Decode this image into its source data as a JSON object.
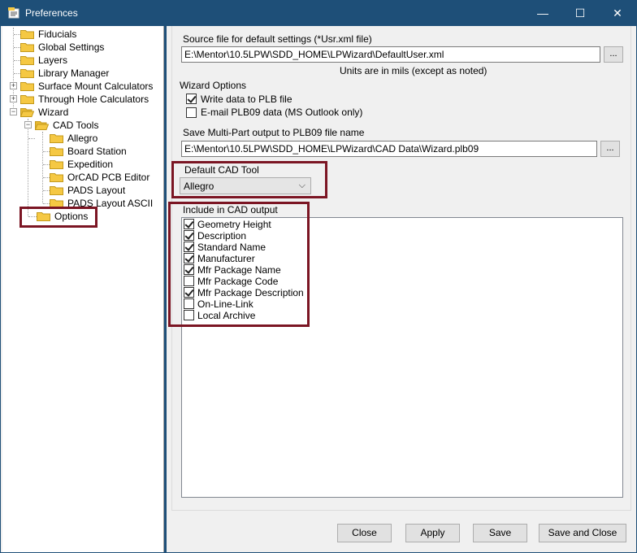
{
  "window": {
    "title": "Preferences"
  },
  "tree": {
    "items": [
      {
        "label": "Fiducials"
      },
      {
        "label": "Global Settings"
      },
      {
        "label": "Layers"
      },
      {
        "label": "Library Manager"
      },
      {
        "label": "Surface Mount Calculators"
      },
      {
        "label": "Through Hole Calculators"
      },
      {
        "label": "Wizard"
      },
      {
        "label": "CAD Tools"
      },
      {
        "label": "Allegro"
      },
      {
        "label": "Board Station"
      },
      {
        "label": "Expedition"
      },
      {
        "label": "OrCAD PCB Editor"
      },
      {
        "label": "PADS Layout"
      },
      {
        "label": "PADS Layout ASCII"
      },
      {
        "label": "Options"
      }
    ],
    "expand_plus": "+",
    "expand_minus": "−"
  },
  "source": {
    "label": "Source file for default settings (*Usr.xml file)",
    "value": "E:\\Mentor\\10.5LPW\\SDD_HOME\\LPWizard\\DefaultUser.xml",
    "browse": "...",
    "units_note": "Units are in mils (except as noted)"
  },
  "wizard_options": {
    "label": "Wizard Options",
    "write_plb": {
      "label": "Write data to PLB file",
      "checked": true
    },
    "email_plb": {
      "label": "E-mail PLB09 data  (MS Outlook only)",
      "checked": false
    }
  },
  "multipart": {
    "label": "Save Multi-Part output to PLB09 file name",
    "value": "E:\\Mentor\\10.5LPW\\SDD_HOME\\LPWizard\\CAD Data\\Wizard.plb09",
    "browse": "..."
  },
  "default_cad": {
    "label": "Default CAD Tool",
    "selected": "Allegro",
    "arrow": "⌵"
  },
  "cad_output": {
    "label": "Include in CAD output",
    "items": [
      {
        "label": "Geometry Height",
        "checked": true
      },
      {
        "label": "Description",
        "checked": true
      },
      {
        "label": "Standard Name",
        "checked": true
      },
      {
        "label": "Manufacturer",
        "checked": true
      },
      {
        "label": "Mfr Package Name",
        "checked": true
      },
      {
        "label": "Mfr Package Code",
        "checked": false
      },
      {
        "label": "Mfr Package Description",
        "checked": true
      },
      {
        "label": "On-Line-Link",
        "checked": false
      },
      {
        "label": "Local Archive",
        "checked": false
      }
    ]
  },
  "buttons": {
    "close": "Close",
    "apply": "Apply",
    "save": "Save",
    "save_close": "Save and Close"
  },
  "titlebar_buttons": {
    "minimize": "—",
    "maximize": "☐",
    "close": "✕"
  },
  "colors": {
    "titlebar": "#1e4f78",
    "highlight": "#7b1523",
    "folder": "#f5c843"
  }
}
